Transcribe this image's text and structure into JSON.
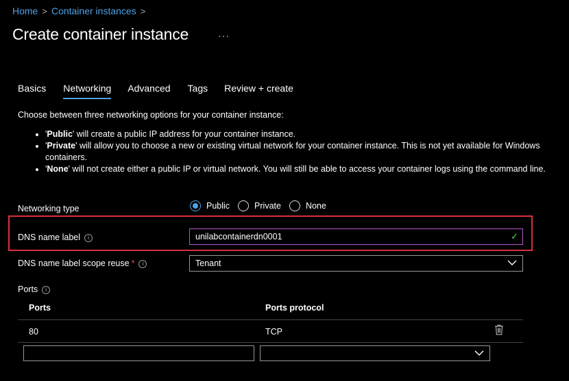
{
  "breadcrumb": {
    "home": "Home",
    "sep": ">",
    "instances": "Container instances"
  },
  "page_title": "Create container instance",
  "more_label": "···",
  "tabs": [
    "Basics",
    "Networking",
    "Advanced",
    "Tags",
    "Review + create"
  ],
  "active_tab": "Networking",
  "description": "Choose between three networking options for your container instance:",
  "bullets": [
    {
      "bold": "Public",
      "pre": "'",
      "post": "' will create a public IP address for your container instance."
    },
    {
      "bold": "Private",
      "pre": "'",
      "post": "' will allow you to choose a new or existing virtual network for your container instance. This is not yet available for Windows containers."
    },
    {
      "bold": "None",
      "pre": "'",
      "post": "' will not create either a public IP or virtual network. You will still be able to access your container logs using the command line."
    }
  ],
  "networking_type": {
    "label": "Networking type",
    "options": [
      "Public",
      "Private",
      "None"
    ],
    "selected": "Public"
  },
  "dns_label": {
    "label": "DNS name label",
    "value": "unilabcontainerdn0001",
    "check": "✓"
  },
  "scope_reuse": {
    "label": "DNS name label scope reuse",
    "required": "*",
    "value": "Tenant"
  },
  "ports": {
    "label": "Ports",
    "col_ports": "Ports",
    "col_protocol": "Ports protocol",
    "rows": [
      {
        "port": "80",
        "protocol": "TCP"
      }
    ],
    "new_port_placeholder": "",
    "new_protocol_value": ""
  },
  "info_glyph": "i",
  "colors": {
    "accent": "#4fa1e8",
    "highlight": "#d9303a",
    "valid": "#5fd068"
  }
}
